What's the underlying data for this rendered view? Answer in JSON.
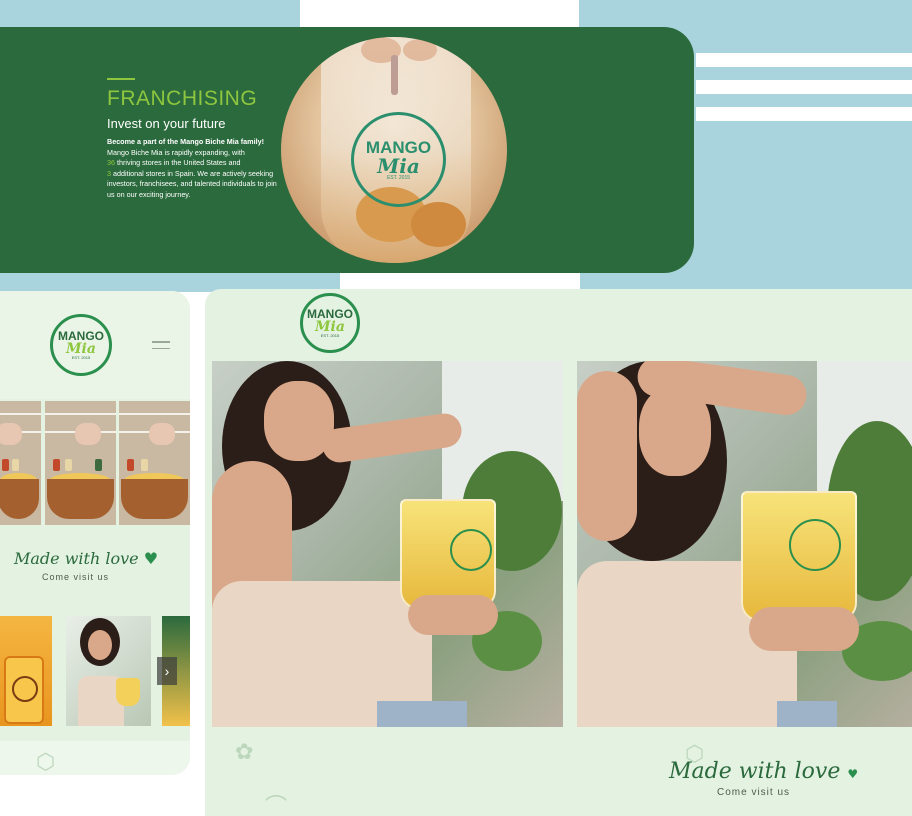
{
  "hero": {
    "title": "FRANCHISING",
    "subtitle": "Invest on your future",
    "lead": "Become a part of the Mango Biche Mia family!",
    "body_1": "Mango Biche Mia is rapidly expanding, with",
    "count_us": "36",
    "body_2": " thriving stores in the United States and",
    "count_spain": "3",
    "body_3": " additional stores in Spain. We are actively seeking investors, franchisees, and talented individuals to join us on our exciting journey."
  },
  "logo": {
    "line1": "MANGO",
    "line2": "Mia",
    "est": "EST. 2015"
  },
  "mobile": {
    "made_with_love": "Made with love",
    "come_visit": "Come visit us",
    "arrow": "›"
  },
  "desktop": {
    "made_with_love": "Made with love",
    "come_visit": "Come visit us"
  },
  "colors": {
    "brand_green": "#2b6a3d",
    "accent_lime": "#8ec63f",
    "mint_bg": "#e3f2e1",
    "sky_blue": "#a9d3dd"
  },
  "icons": [
    "hamburger-menu-icon",
    "heart-icon",
    "chevron-right-icon"
  ]
}
